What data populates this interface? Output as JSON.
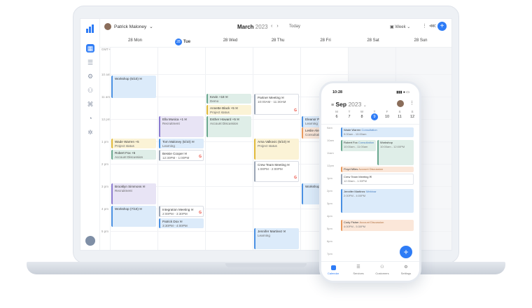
{
  "header": {
    "user": "Patrick Maloney",
    "month": "March",
    "year": "2023",
    "today": "Today",
    "view": "Week",
    "add": "+"
  },
  "days": [
    "28 Mon",
    "28",
    "Tue",
    "28 Wed",
    "28 Thu",
    "28 Fri",
    "28 Sat",
    "28 Sun"
  ],
  "times": [
    "GMT+",
    "10 am",
    "11 am",
    "12 pm",
    "1 pm",
    "2 pm",
    "3 pm",
    "4 pm",
    "5 pm"
  ],
  "events": {
    "e1": {
      "t": "Workshop (5/10) ✉",
      "s": ""
    },
    "e2": {
      "t": "Ella Musica +1 ✉",
      "s": "Recruitment"
    },
    "e3": {
      "t": "Kevin +18 ✉",
      "s": "Demo"
    },
    "e4": {
      "t": "Annette Black +5 ✉",
      "s": "Project status"
    },
    "e5": {
      "t": "Esther Howard +5 ✉",
      "s": "Account Discussion"
    },
    "e6": {
      "t": "Partner Meeting ✉",
      "s": "10:00AM - 11:30AM"
    },
    "e7": {
      "t": "Eleanor Pen",
      "s": "Learning"
    },
    "e8": {
      "t": "Leslie Alex",
      "s": "Consultati"
    },
    "e9": {
      "t": "Tom Maloney (5/10) ✉",
      "s": "Learning"
    },
    "e10": {
      "t": "Wade Warren +5",
      "s": "Project status"
    },
    "e11": {
      "t": "Robert Fox +5",
      "s": "Account Discussion"
    },
    "e12": {
      "t": "Bessie Cooper ✉",
      "s": "12:30PM - 1:00PM"
    },
    "e13": {
      "t": "Arna Valkovic (5/10) ✉",
      "s": "Project status"
    },
    "e14": {
      "t": "Crew Team Meeting ✉",
      "s": "1:00PM - 2:00PM"
    },
    "e15": {
      "t": "Brooklyn Simmons ✉",
      "s": "Recruitment"
    },
    "e16": {
      "t": "Workshop",
      "s": ""
    },
    "e17": {
      "t": "Workshop (7/10) ✉",
      "s": ""
    },
    "e18": {
      "t": "Integration Meeting ✉",
      "s": "2:00PM - 3:30PM"
    },
    "e19": {
      "t": "Patrick Dox ✉",
      "s": "3:30PM - 4:00PM"
    },
    "e20": {
      "t": "Jennifer Martinez ✉",
      "s": "Learning"
    }
  },
  "phone": {
    "time": "10:28",
    "status_right": "▮▮▮ ● ▭",
    "month": "Sep",
    "year": "2023",
    "weekdays": [
      "M",
      "T",
      "W",
      "T",
      "F",
      "S",
      "S"
    ],
    "dates": [
      "6",
      "7",
      "8",
      "9",
      "10",
      "11",
      "12"
    ],
    "times": [
      "9am",
      "10am",
      "11am",
      "12pm",
      "1pm",
      "2pm",
      "3pm",
      "4pm",
      "5pm",
      "6pm",
      "7pm"
    ],
    "events": {
      "p1": {
        "t": "Wade Warren",
        "s": "Consultation",
        "u": "9:00am - 10:00am"
      },
      "p2": {
        "t": "Robert Fox",
        "s": "Consultation",
        "u": "10:00am - 11:00am"
      },
      "p3": {
        "t": "Workshop",
        "s": "",
        "u": "10:00am - 12:00PM"
      },
      "p4": {
        "t": "Floyd Miles",
        "s": "Account Discussion",
        "u": ""
      },
      "p5": {
        "t": "Crew Team Meeting ✉",
        "s": "",
        "u": "12:30am - 1:30PM"
      },
      "p6": {
        "t": "Jennifer Martinez",
        "s": "Webinar",
        "u": "2:00PM - 4:00PM"
      },
      "p7": {
        "t": "Cody Fisher",
        "s": "Account Discussion",
        "u": "4:00PM - 5:30PM"
      }
    },
    "tabs": [
      "Calendar",
      "Services",
      "Customers",
      "Settings"
    ],
    "add": "+"
  }
}
